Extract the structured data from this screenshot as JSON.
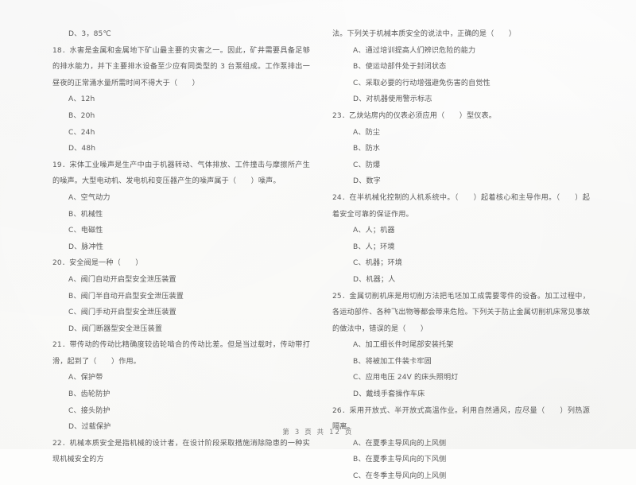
{
  "document": {
    "type": "multiple-choice-exam-page",
    "footer": "第 3 页 共 12 页"
  },
  "left_column": {
    "blocks": [
      {
        "kind": "option",
        "text": "D、3，85℃"
      },
      {
        "kind": "stem",
        "text": "18．水害是金属和金属地下矿山最主要的灾害之一。因此，矿井需要具备足够的排水能力，并下主要排水设备至少应有同类型的 3 台泵组成。工作泵排出一昼夜的正常涌水量所需时间不得大于（　　）"
      },
      {
        "kind": "option",
        "text": "A、12h"
      },
      {
        "kind": "option",
        "text": "B、20h"
      },
      {
        "kind": "option",
        "text": "C、24h"
      },
      {
        "kind": "option",
        "text": "D、48h"
      },
      {
        "kind": "stem",
        "text": "19．宋体工业噪声是生产中由于机器转动、气体排放、工件撞击与摩擦所产生的噪声。大型电动机、发电机和变压器产生的噪声属于（　　）噪声。"
      },
      {
        "kind": "option",
        "text": "A、空气动力"
      },
      {
        "kind": "option",
        "text": "B、机械性"
      },
      {
        "kind": "option",
        "text": "C、电磁性"
      },
      {
        "kind": "option",
        "text": "D、脉冲性"
      },
      {
        "kind": "stem",
        "text": "20．安全阀是一种（　　）"
      },
      {
        "kind": "option",
        "text": "A、阀门自动开启型安全泄压装置"
      },
      {
        "kind": "option",
        "text": "B、阀门半自动开启型安全泄压装置"
      },
      {
        "kind": "option",
        "text": "C、阀门手动开启型安全泄压装置"
      },
      {
        "kind": "option",
        "text": "D、阀门断器型安全泄压装置"
      },
      {
        "kind": "stem",
        "text": "21．带传动的传动比精确度较齿轮啮合的传动比差。但是当过载时，传动带打滑，起到了（　　）作用。"
      },
      {
        "kind": "option",
        "text": "A、保护带"
      },
      {
        "kind": "option",
        "text": "B、齿轮防护"
      },
      {
        "kind": "option",
        "text": "C、接头防护"
      },
      {
        "kind": "option",
        "text": "D、过载保护"
      },
      {
        "kind": "stem",
        "text": "22．机械本质安全是指机械的设计者，在设计阶段采取措施消除隐患的一种实现机械安全的方"
      }
    ]
  },
  "right_column": {
    "blocks": [
      {
        "kind": "stem",
        "text": "法。下列关于机械本质安全的说法中，正确的是（　　）"
      },
      {
        "kind": "option",
        "text": "A、通过培训提高人们辨识危险的能力"
      },
      {
        "kind": "option",
        "text": "B、使运动部件处于封闭状态"
      },
      {
        "kind": "option",
        "text": "C、采取必要的行动增强避免伤害的自觉性"
      },
      {
        "kind": "option",
        "text": "D、对机器使用警示标志"
      },
      {
        "kind": "stem",
        "text": "23．乙炔站房内的仪表必须应用（　　）型仪表。"
      },
      {
        "kind": "option",
        "text": "A、防尘"
      },
      {
        "kind": "option",
        "text": "B、防水"
      },
      {
        "kind": "option",
        "text": "C、防爆"
      },
      {
        "kind": "option",
        "text": "D、数字"
      },
      {
        "kind": "stem",
        "text": "24．在半机械化控制的人机系统中。（　　）起着核心和主导作用。（　　）起着安全可靠的保证作用。"
      },
      {
        "kind": "option",
        "text": "A、人；机器"
      },
      {
        "kind": "option",
        "text": "B、人；环境"
      },
      {
        "kind": "option",
        "text": "C、机器；环境"
      },
      {
        "kind": "option",
        "text": "D、机器；人"
      },
      {
        "kind": "stem",
        "text": "25．金属切削机床是用切削方法把毛坯加工成需要零件的设备。加工过程中，各运动部件、各种飞出物等都会带来危险。下列关于防止金属切削机床常见事故的做法中，错误的是（　　）"
      },
      {
        "kind": "option",
        "text": "A、加工细长件时尾部安装托架"
      },
      {
        "kind": "option",
        "text": "B、将被加工件装卡牢固"
      },
      {
        "kind": "option",
        "text": "C、应用电压 24V 的床头照明灯"
      },
      {
        "kind": "option",
        "text": "D、戴线手套操作车床"
      },
      {
        "kind": "stem",
        "text": "26．采用开放式、半开放式高温作业。利用自然通风，应尽量（　　）列热源隔离。"
      },
      {
        "kind": "option",
        "text": "A、在夏季主导风向的上风侧"
      },
      {
        "kind": "option",
        "text": "B、在夏季主导风向的下风侧"
      },
      {
        "kind": "option",
        "text": "C、在冬季主导风向的上风侧"
      }
    ]
  }
}
